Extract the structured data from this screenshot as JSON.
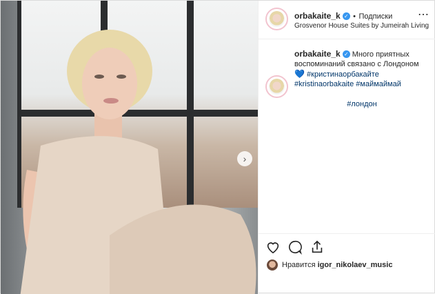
{
  "header": {
    "username": "orbakaite_k",
    "follow_separator": "•",
    "follow_label": "Подписки",
    "location": "Grosvenor House Suites by Jumeirah Living",
    "more_icon": "⋯"
  },
  "caption": {
    "username": "orbakaite_k",
    "text": "Много приятных воспоминаний связано с Лондоном",
    "emoji": "💙",
    "hashtags": [
      "#кристинаорбакайте",
      "#kristinaorbakaite",
      "#маймаймай",
      "#лондон"
    ]
  },
  "likes": {
    "prefix": "Нравится",
    "user": "igor_nikolaev_music"
  },
  "icons": {
    "next": "›"
  },
  "colors": {
    "link": "#003569",
    "verified": "#3897f0",
    "border": "#dbdbdb"
  }
}
